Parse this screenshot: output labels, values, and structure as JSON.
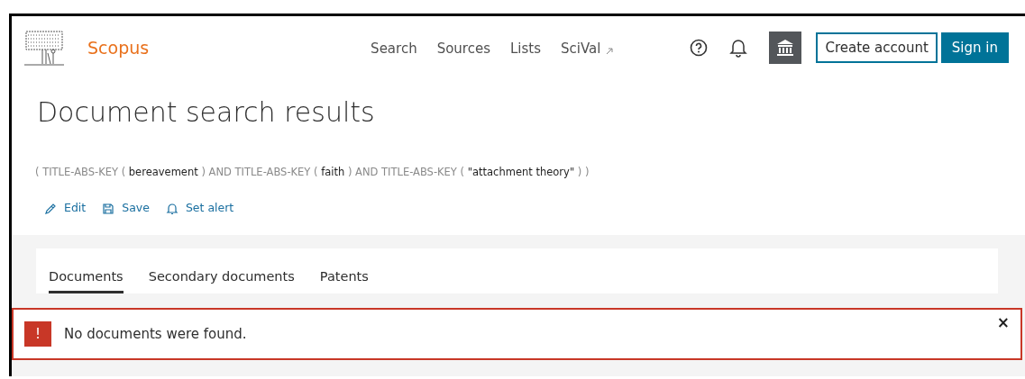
{
  "header": {
    "brand": "Scopus",
    "nav": [
      {
        "label": "Search"
      },
      {
        "label": "Sources"
      },
      {
        "label": "Lists"
      },
      {
        "label": "SciVal",
        "external": true
      }
    ],
    "buttons": [
      {
        "label": "Create account",
        "kind": "outline"
      },
      {
        "label": "Sign in",
        "kind": "primary"
      }
    ]
  },
  "title": "Document search results",
  "query": [
    {
      "text": "( TITLE-ABS-KEY (",
      "kind": "operator"
    },
    {
      "text": "bereavement",
      "kind": "term"
    },
    {
      "text": ") AND TITLE-ABS-KEY (",
      "kind": "operator"
    },
    {
      "text": "faith",
      "kind": "term"
    },
    {
      "text": ") AND TITLE-ABS-KEY (",
      "kind": "operator"
    },
    {
      "text": "\"attachment theory\"",
      "kind": "term"
    },
    {
      "text": ") )",
      "kind": "operator"
    }
  ],
  "actions": [
    {
      "label": "Edit",
      "kind": "edit"
    },
    {
      "label": "Save",
      "kind": "save"
    },
    {
      "label": "Set alert",
      "kind": "alert"
    }
  ],
  "tabs": [
    {
      "label": "Documents",
      "selected": true
    },
    {
      "label": "Secondary documents",
      "selected": false
    },
    {
      "label": "Patents",
      "selected": false
    }
  ],
  "alert": {
    "icon": "!",
    "message": "No documents were found.",
    "close": "×"
  }
}
